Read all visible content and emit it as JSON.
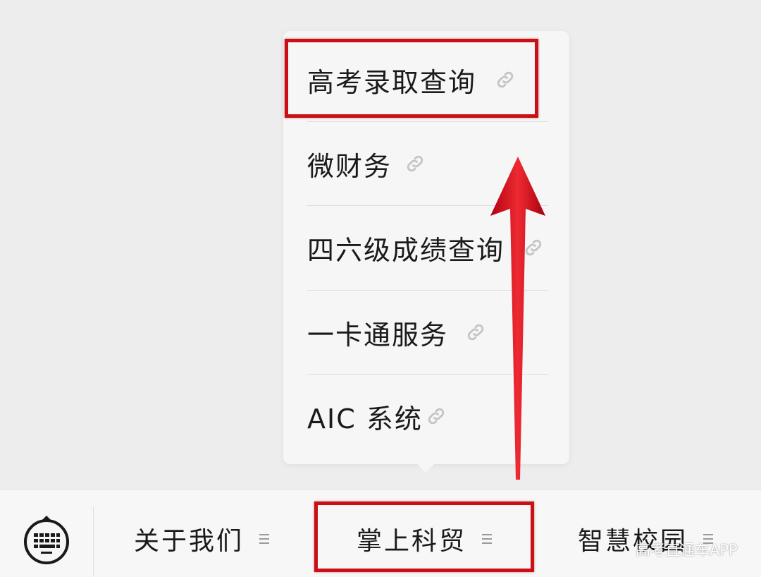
{
  "menu": {
    "items": [
      {
        "label": "高考录取查询",
        "icon": "link-icon",
        "highlighted": true
      },
      {
        "label": "微财务",
        "icon": "link-icon",
        "highlighted": false
      },
      {
        "label": "四六级成绩查询",
        "icon": "link-icon",
        "highlighted": false
      },
      {
        "label": "一卡通服务",
        "icon": "link-icon",
        "highlighted": false
      },
      {
        "label": "AIC 系统",
        "icon": "link-icon",
        "highlighted": false
      }
    ]
  },
  "bottom_bar": {
    "keyboard_icon": "keyboard-icon",
    "tabs": [
      {
        "label": "关于我们",
        "icon": "menu-lines-icon"
      },
      {
        "label": "掌上科贸",
        "icon": "menu-lines-icon",
        "highlighted": true
      },
      {
        "label": "智慧校园",
        "icon": "menu-lines-icon"
      }
    ]
  },
  "watermark": "高考直通车APP",
  "colors": {
    "highlight": "#c81016",
    "arrow": "#d0101a",
    "background": "#ededed",
    "menu_background": "#f6f6f6"
  }
}
